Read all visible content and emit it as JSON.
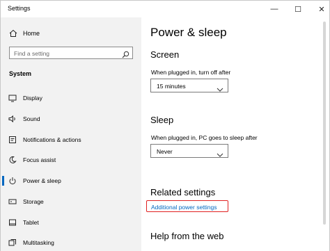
{
  "window": {
    "title": "Settings",
    "controls": {
      "minimize": "—",
      "maximize": "☐",
      "close": "✕"
    }
  },
  "sidebar": {
    "home_label": "Home",
    "search_placeholder": "Find a setting",
    "section_label": "System",
    "items": [
      {
        "label": "Display",
        "icon": "display-icon"
      },
      {
        "label": "Sound",
        "icon": "sound-icon"
      },
      {
        "label": "Notifications & actions",
        "icon": "notifications-icon"
      },
      {
        "label": "Focus assist",
        "icon": "focus-assist-icon"
      },
      {
        "label": "Power & sleep",
        "icon": "power-icon",
        "active": true
      },
      {
        "label": "Storage",
        "icon": "storage-icon"
      },
      {
        "label": "Tablet",
        "icon": "tablet-icon"
      },
      {
        "label": "Multitasking",
        "icon": "multitasking-icon"
      }
    ]
  },
  "main": {
    "title": "Power & sleep",
    "screen": {
      "heading": "Screen",
      "label": "When plugged in, turn off after",
      "value": "15 minutes"
    },
    "sleep": {
      "heading": "Sleep",
      "label": "When plugged in, PC goes to sleep after",
      "value": "Never"
    },
    "related": {
      "heading": "Related settings",
      "link": "Additional power settings"
    },
    "help": {
      "heading": "Help from the web"
    }
  },
  "colors": {
    "accent": "#0067c0",
    "highlight": "#e02020",
    "sidebar_bg": "#f2f2f2"
  }
}
